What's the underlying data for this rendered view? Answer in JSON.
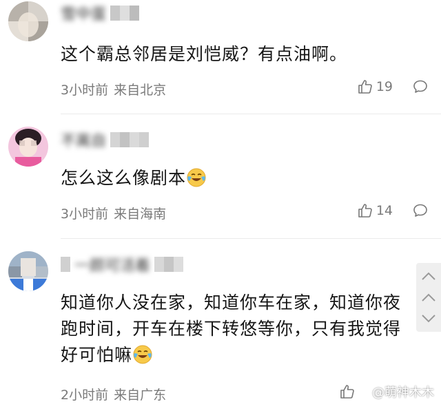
{
  "comments": [
    {
      "username": "雪中蛋",
      "text": "这个霸总邻居是刘恺威？有点油啊。",
      "time": "3小时前",
      "location": "来自北京",
      "likes": "19",
      "avatar": "avatar-photo",
      "emoji": ""
    },
    {
      "username": "不离自",
      "text": "怎么这么像剧本",
      "time": "3小时前",
      "location": "来自海南",
      "likes": "14",
      "avatar": "avatar-photo",
      "emoji": "laugh-cry-emoji"
    },
    {
      "username": "一颜可活着",
      "text": "知道你人没在家，知道你车在家，知道你夜跑时间，开车在楼下转悠等你，只有我觉得好可怕嘛",
      "time": "2小时前",
      "location": "来自广东",
      "likes": "",
      "avatar": "avatar-photo",
      "emoji": "laugh-cry-emoji"
    }
  ],
  "watermark": {
    "text": "@萌神木木",
    "icon": "weibo-logo-icon"
  },
  "icons": {
    "like": "thumbs-up-icon",
    "reply": "comment-bubble-icon",
    "scroll_up": "chevron-up-icon",
    "scroll_down": "chevron-down-icon"
  },
  "colors": {
    "text_primary": "#161616",
    "text_secondary": "#7a7a7a",
    "divider": "#ebebeb",
    "background": "#ffffff"
  }
}
